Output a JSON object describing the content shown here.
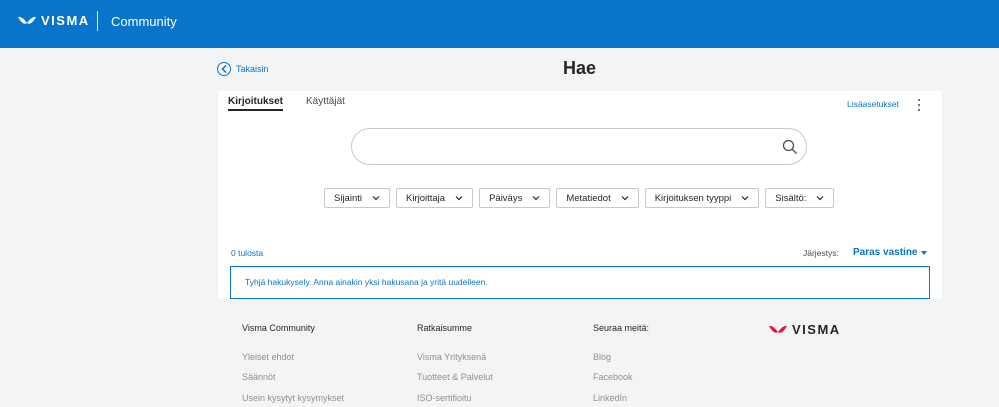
{
  "header": {
    "brand": "VISMA",
    "community_label": "Community"
  },
  "nav": {
    "back_label": "Takaisin",
    "page_title": "Hae"
  },
  "tabs": [
    {
      "label": "Kirjoitukset",
      "active": true
    },
    {
      "label": "Käyttäjät",
      "active": false
    }
  ],
  "toolbar": {
    "advanced_label": "Lisäasetukset"
  },
  "search": {
    "value": "",
    "placeholder": ""
  },
  "filters": [
    {
      "label": "Sijainti"
    },
    {
      "label": "Kirjoittaja"
    },
    {
      "label": "Päiväys"
    },
    {
      "label": "Metatiedot"
    },
    {
      "label": "Kirjoituksen tyyppi"
    },
    {
      "label": "Sisältö:"
    }
  ],
  "results": {
    "count_label": "0 tulosta",
    "sort_label": "Järjestys:",
    "sort_value": "Paras vastine",
    "empty_message": "Tyhjä hakukysely. Anna ainakin yksi hakusana ja yritä uudelleen."
  },
  "footer": {
    "columns": [
      {
        "heading": "Visma Community",
        "links": [
          "Yleiset ehdot",
          "Säännöt",
          "Usein kysytyt kysymykset"
        ]
      },
      {
        "heading": "Ratkaisumme",
        "links": [
          "Visma Yrityksenä",
          "Tuotteet & Palvelut",
          "ISO-sertifioitu"
        ]
      },
      {
        "heading": "Seuraa meitä:",
        "links": [
          "Blog",
          "Facebook",
          "LinkedIn"
        ]
      }
    ],
    "brand": "VISMA"
  },
  "colors": {
    "header_bg": "#0974c9",
    "accent": "#0974c9",
    "page_bg": "#f3f4f5",
    "logo_red": "#e5173f"
  }
}
